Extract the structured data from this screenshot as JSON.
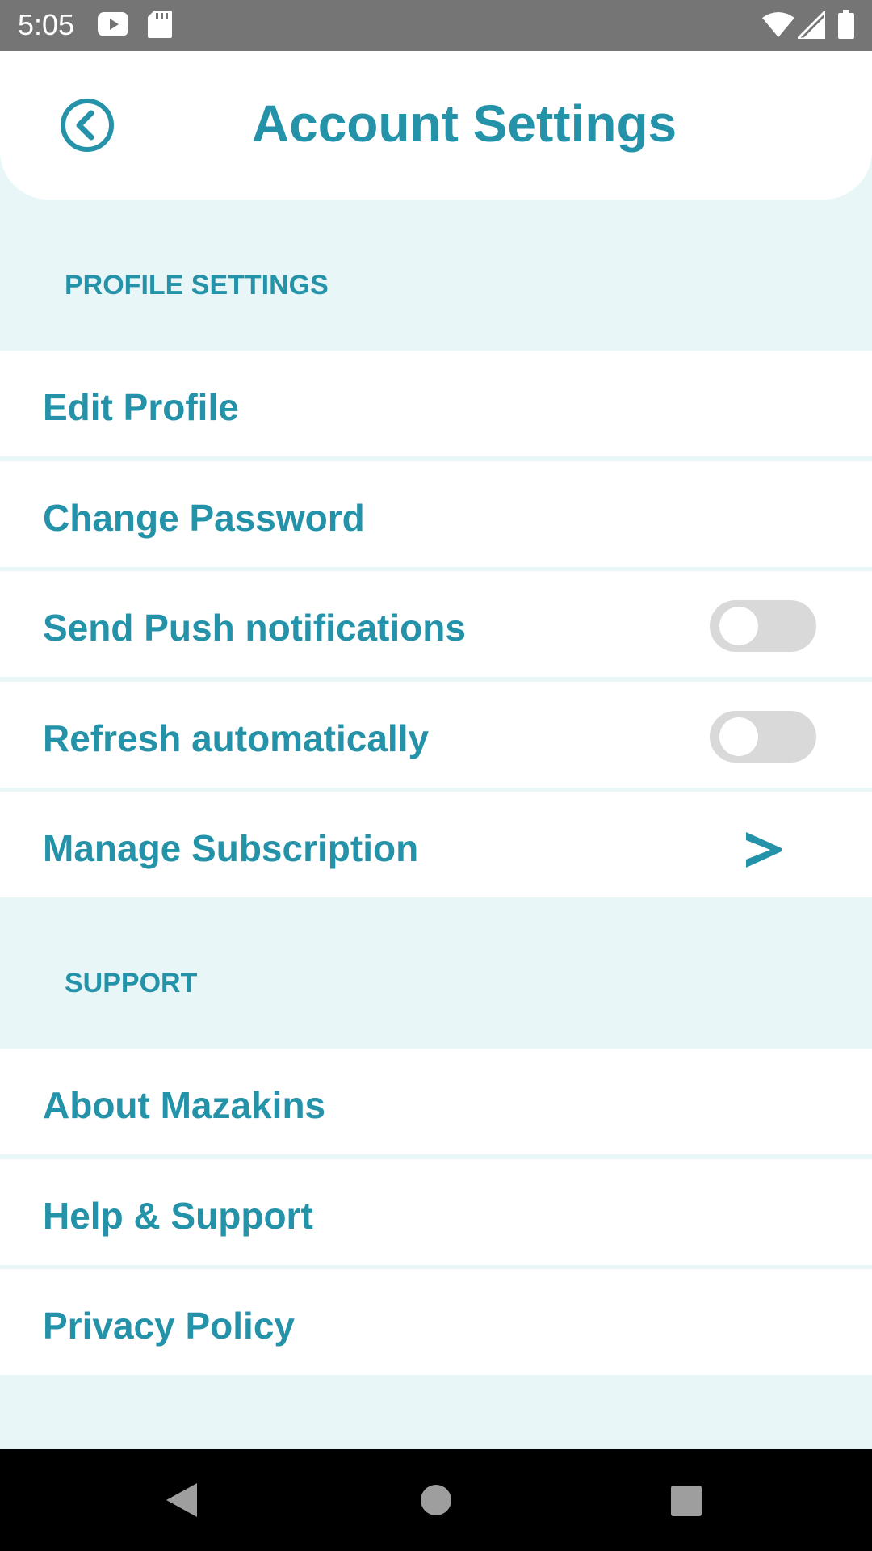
{
  "status_bar": {
    "time": "5:05",
    "icons": [
      "youtube-icon",
      "sd-card-icon",
      "wifi-icon",
      "signal-icon",
      "battery-icon"
    ]
  },
  "header": {
    "title": "Account Settings",
    "back_icon": "back-circle-icon"
  },
  "sections": {
    "profile": {
      "title": "PROFILE SETTINGS",
      "items": [
        {
          "label": "Edit Profile"
        },
        {
          "label": "Change Password"
        },
        {
          "label": "Send Push notifications",
          "toggle": false
        },
        {
          "label": "Refresh automatically",
          "toggle": false
        },
        {
          "label": "Manage Subscription",
          "chevron": ">"
        }
      ]
    },
    "support": {
      "title": "SUPPORT",
      "items": [
        {
          "label": "About Mazakins"
        },
        {
          "label": "Help & Support"
        },
        {
          "label": "Privacy Policy"
        }
      ]
    }
  },
  "nav_bar": {
    "buttons": [
      "back-triangle-icon",
      "home-circle-icon",
      "recents-square-icon"
    ]
  },
  "colors": {
    "accent": "#2492a8",
    "section_bg": "#e8f6f7",
    "row_bg": "#ffffff",
    "toggle_off": "#d9d9d9"
  }
}
